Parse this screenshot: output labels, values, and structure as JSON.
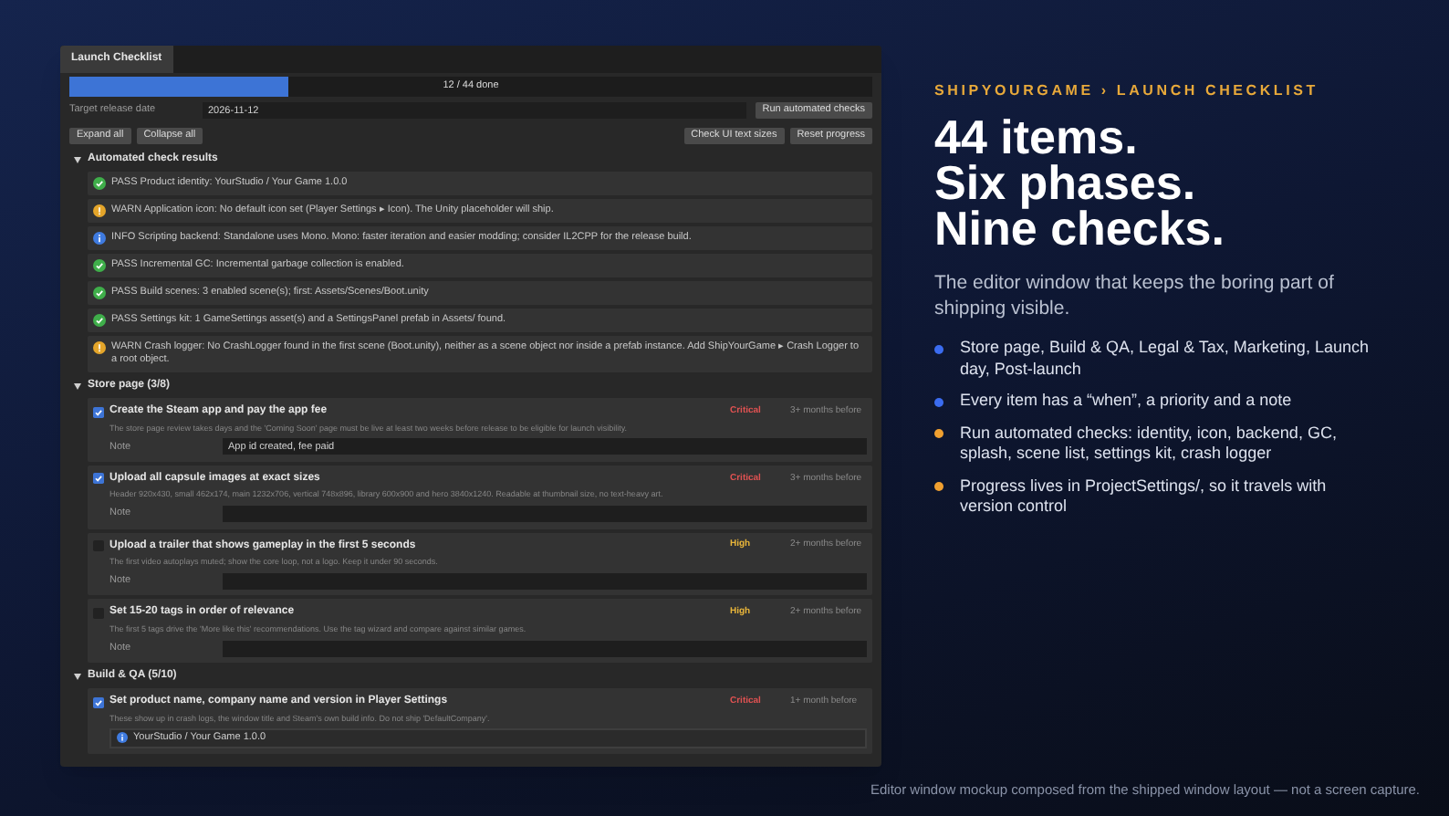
{
  "window": {
    "tab": "Launch Checklist"
  },
  "progress": {
    "level": 0.2727,
    "label": "12 / 44 done"
  },
  "release_date": {
    "label": "Target release date",
    "value": "2026-11-12"
  },
  "toolbar": {
    "left": [
      "Expand all",
      "Collapse all"
    ],
    "right": [
      "Check UI text sizes",
      "Reset progress"
    ],
    "run": "Run automated checks"
  },
  "check_results": {
    "title": "Automated check results",
    "expanded": true,
    "rows": [
      {
        "kind": "pass",
        "text": "PASS Product identity: YourStudio / Your Game 1.0.0"
      },
      {
        "kind": "warn",
        "text": "WARN Application icon: No default icon set (Player Settings ▸ Icon). The Unity placeholder will ship."
      },
      {
        "kind": "info",
        "text": "INFO Scripting backend: Standalone uses Mono. Mono: faster iteration and easier modding; consider IL2CPP for the release build."
      },
      {
        "kind": "pass",
        "text": "PASS Incremental GC: Incremental garbage collection is enabled."
      },
      {
        "kind": "pass",
        "text": "PASS Build scenes: 3 enabled scene(s); first: Assets/Scenes/Boot.unity"
      },
      {
        "kind": "pass",
        "text": "PASS Settings kit: 1 GameSettings asset(s) and a SettingsPanel prefab in Assets/ found."
      },
      {
        "kind": "warn",
        "text": "WARN Crash logger: No CrashLogger found in the first scene (Boot.unity), neither as a scene object nor inside a prefab instance. Add ShipYourGame ▸ Crash Logger to a root object."
      }
    ]
  },
  "phases": [
    {
      "title": "Store page (3/8)",
      "expanded": true,
      "items": [
        {
          "checked": true,
          "title": "Create the Steam app and pay the app fee",
          "description": "The store page review takes days and the 'Coming Soon' page must be live at least two weeks before release to be eligible for launch visibility.",
          "priority": "Critical",
          "color": "#e05252",
          "when": "3+ months before",
          "note_label": "Note",
          "note": "App id created, fee paid"
        },
        {
          "checked": true,
          "title": "Upload all capsule images at exact sizes",
          "description": "Header 920x430, small 462x174, main 1232x706, vertical 748x896, library 600x900 and hero 3840x1240. Readable at thumbnail size, no text-heavy art.",
          "priority": "Critical",
          "color": "#e05252",
          "when": "3+ months before",
          "note_label": "Note"
        },
        {
          "checked": false,
          "title": "Upload a trailer that shows gameplay in the first 5 seconds",
          "description": "The first video autoplays muted; show the core loop, not a logo. Keep it under 90 seconds.",
          "priority": "High",
          "color": "#e8b53a",
          "when": "2+ months before",
          "note_label": "Note"
        },
        {
          "checked": false,
          "title": "Set 15-20 tags in order of relevance",
          "description": "The first 5 tags drive the 'More like this' recommendations. Use the tag wizard and compare against similar games.",
          "priority": "High",
          "color": "#e8b53a",
          "when": "2+ months before",
          "note_label": "Note"
        }
      ]
    },
    {
      "title": "Build & QA (5/10)",
      "expanded": true,
      "items": [
        {
          "checked": true,
          "title": "Set product name, company name and version in Player Settings",
          "description": "These show up in crash logs, the window title and Steam's own build info. Do not ship 'DefaultCompany'.",
          "priority": "Critical",
          "color": "#e05252",
          "when": "1+ month before",
          "info": "YourStudio / Your Game 1.0.0"
        }
      ]
    }
  ],
  "panel": {
    "eyebrow": "SHIPYOURGAME › LAUNCH CHECKLIST",
    "headline": [
      "44 items.",
      "Six phases.",
      "Nine checks."
    ],
    "lede": "The editor window that keeps the boring part of shipping visible.",
    "bullets": [
      {
        "text": "Store page, Build & QA, Legal & Tax, Marketing, Launch day, Post-launch",
        "color": "#3b6cf0"
      },
      {
        "text": "Every item has a “when”, a priority and a note",
        "color": "#3b6cf0"
      },
      {
        "text": "Run automated checks: identity, icon, backend, GC, splash, scene list, settings kit, crash logger",
        "color": "#f0a030"
      },
      {
        "text": "Progress lives in ProjectSettings/, so it travels with version control",
        "color": "#f0a030"
      }
    ]
  },
  "caption": "Editor window mockup composed from the shipped window layout — not a screen capture."
}
